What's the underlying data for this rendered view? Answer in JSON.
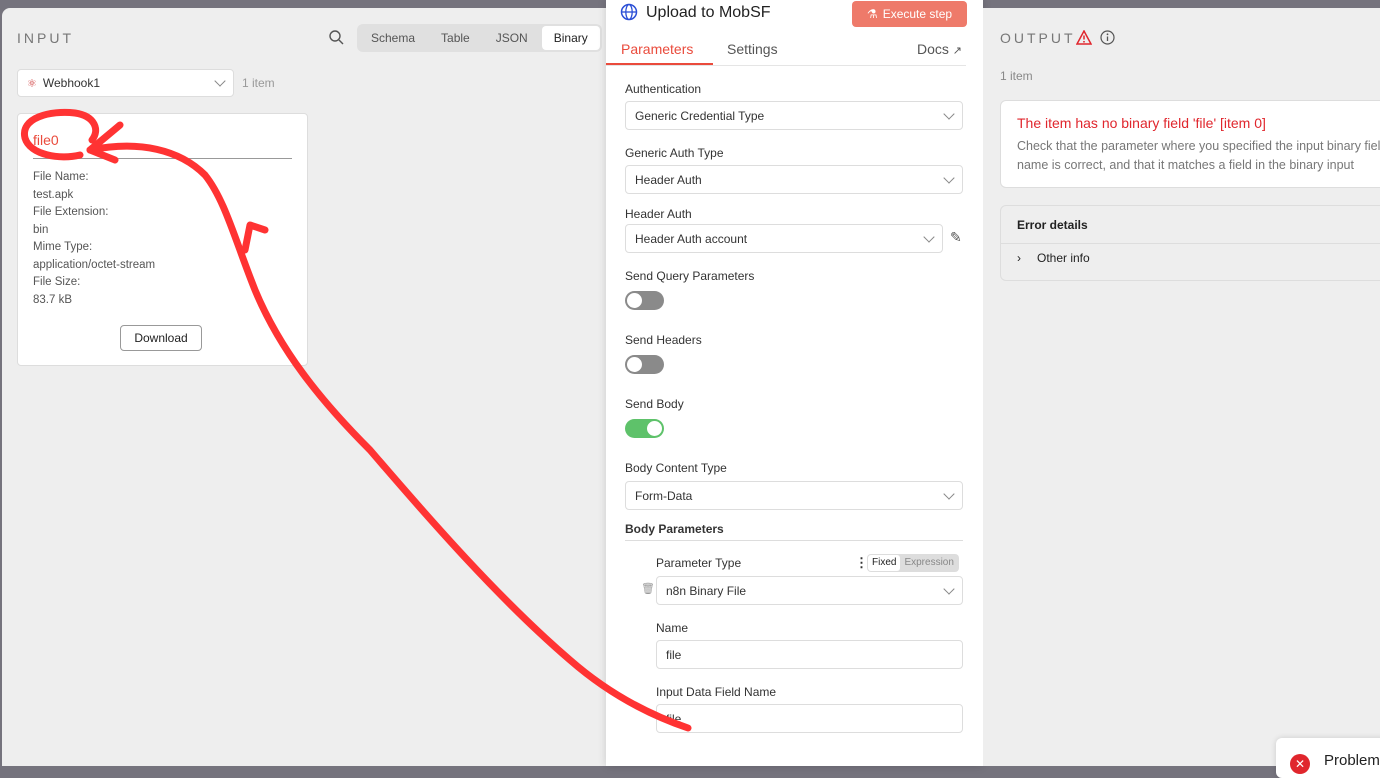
{
  "input": {
    "title": "INPUT",
    "view_tabs": [
      "Schema",
      "Table",
      "JSON",
      "Binary"
    ],
    "active_tab": "Binary",
    "source_node": "Webhook1",
    "item_count": "1 item",
    "binary": {
      "key": "file0",
      "fields": [
        {
          "label": "File Name:",
          "value": "test.apk"
        },
        {
          "label": "File Extension:",
          "value": "bin"
        },
        {
          "label": "Mime Type:",
          "value": "application/octet-stream"
        },
        {
          "label": "File Size:",
          "value": "83.7 kB"
        }
      ],
      "download_label": "Download"
    }
  },
  "node": {
    "title": "Upload to MobSF",
    "execute_label": "Execute step",
    "tabs": [
      "Parameters",
      "Settings"
    ],
    "docs_label": "Docs",
    "authentication": {
      "label": "Authentication",
      "value": "Generic Credential Type"
    },
    "generic_auth_type": {
      "label": "Generic Auth Type",
      "value": "Header Auth"
    },
    "header_auth": {
      "label": "Header Auth",
      "value": "Header Auth account"
    },
    "send_query": {
      "label": "Send Query Parameters",
      "on": false
    },
    "send_headers": {
      "label": "Send Headers",
      "on": false
    },
    "send_body": {
      "label": "Send Body",
      "on": true
    },
    "body_content_type": {
      "label": "Body Content Type",
      "value": "Form-Data"
    },
    "body_parameters": {
      "label": "Body Parameters",
      "parameter_type_label": "Parameter Type",
      "mode_fixed": "Fixed",
      "mode_expression": "Expression",
      "parameter_type": "n8n Binary File",
      "name_label": "Name",
      "name_value": "file",
      "input_field_label": "Input Data Field Name",
      "input_field_value": "file"
    }
  },
  "output": {
    "title": "OUTPUT",
    "item_count": "1 item",
    "error_title": "The item has no binary field 'file' [item 0]",
    "error_desc": "Check that the parameter where you specified the input binary field name is correct, and that it matches a field in the binary input",
    "error_details_label": "Error details",
    "other_info_label": "Other info"
  },
  "toast": {
    "title": "Problem"
  },
  "colors": {
    "accent": "#ea4b3c",
    "error": "#e0262d",
    "toggle_on": "#5ec26a",
    "annotation": "#ff3030"
  }
}
